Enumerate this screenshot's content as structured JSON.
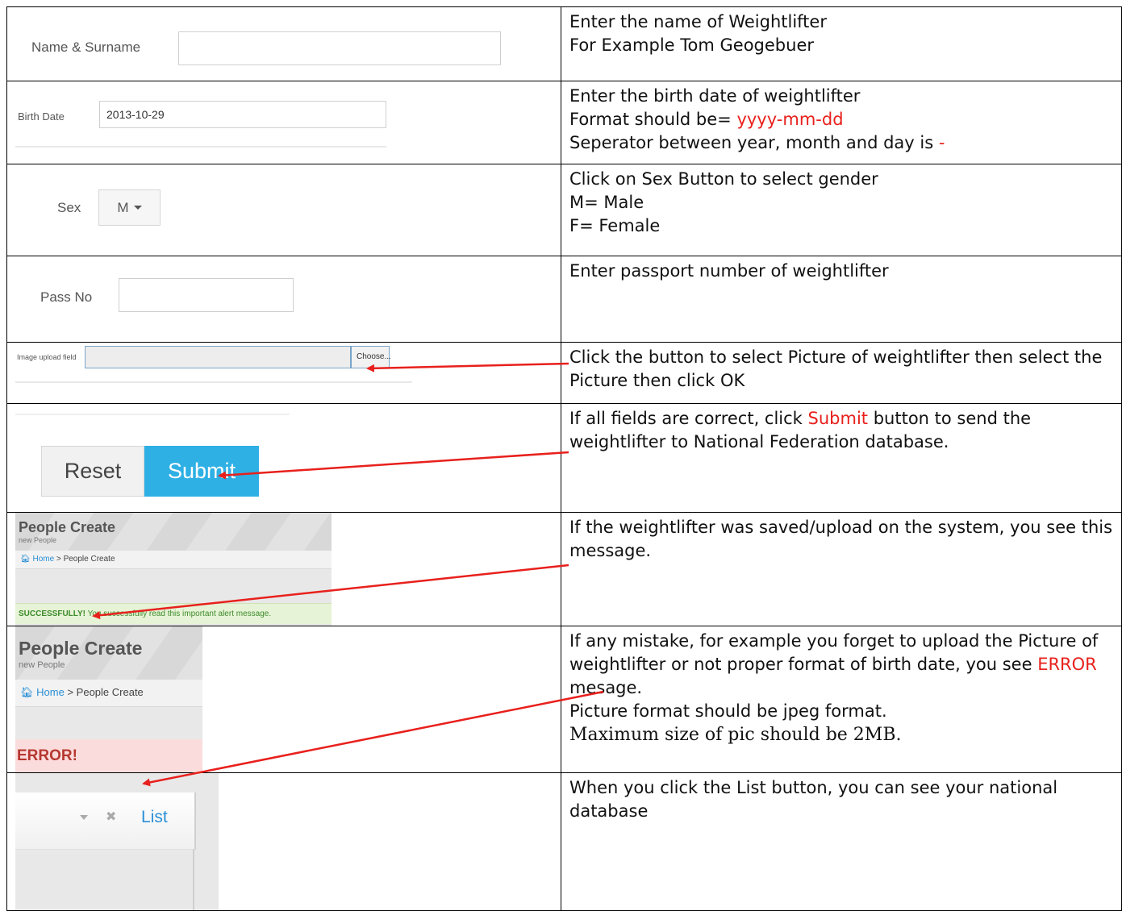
{
  "rows": [
    {
      "ui": {
        "label": "Name & Surname",
        "value": ""
      },
      "desc": [
        "Enter the name of Weightlifter",
        "For Example Tom Geogebuer"
      ]
    },
    {
      "ui": {
        "label": "Birth Date",
        "value": "2013-10-29"
      },
      "desc": [
        "Enter the birth date of weightlifter",
        "Format should be= ",
        "yyyy-mm-dd",
        "Seperator between year, month and day is ",
        "-"
      ]
    },
    {
      "ui": {
        "label": "Sex",
        "value": "M"
      },
      "desc": [
        "Click on Sex Button to select gender",
        "M= Male",
        "F= Female"
      ]
    },
    {
      "ui": {
        "label": "Pass No",
        "value": ""
      },
      "desc": [
        "Enter passport number of weightlifter"
      ]
    },
    {
      "ui": {
        "label": "Image upload field",
        "button": "Choose..."
      },
      "desc": [
        "Click the button to select Picture of weightlifter then select the Picture then click OK"
      ]
    },
    {
      "ui": {
        "reset": "Reset",
        "submit": "Submit"
      },
      "desc": [
        "If all fields are correct, click ",
        "Submit",
        " button to send the weightlifter to National Federation database."
      ]
    },
    {
      "ui": {
        "title": "People Create",
        "subtitle": "new People",
        "crumb_home": "Home",
        "crumb_sep": ">",
        "crumb_page": "People Create",
        "alert_strong": "SUCCESSFULLY!",
        "alert_text": " You successfully read this important alert message."
      },
      "desc": [
        "If the weightlifter was saved/upload on the system, you see this message."
      ]
    },
    {
      "ui": {
        "title": "People Create",
        "subtitle": "new People",
        "crumb_home": "Home",
        "crumb_sep": ">",
        "crumb_page": "People Create",
        "alert_strong": "ERROR!"
      },
      "desc": [
        "If any mistake, for example you forget to upload the Picture of weightlifter or not proper format of birth date, you see ",
        "ERROR",
        " mesage.",
        "Picture format should be jpeg format.",
        "Maximum size of pic should be 2MB."
      ]
    },
    {
      "ui": {
        "list": "List"
      },
      "desc": [
        "When you click the List button, you can see your national database"
      ]
    }
  ],
  "colors": {
    "accent_red": "#e8201c",
    "submit_blue": "#2fb0e5",
    "link_blue": "#2a8fd6",
    "success_bg": "#e6f3d6",
    "success_text": "#3d8b2b",
    "error_bg": "#fbdcdc",
    "error_text": "#b5372f"
  }
}
